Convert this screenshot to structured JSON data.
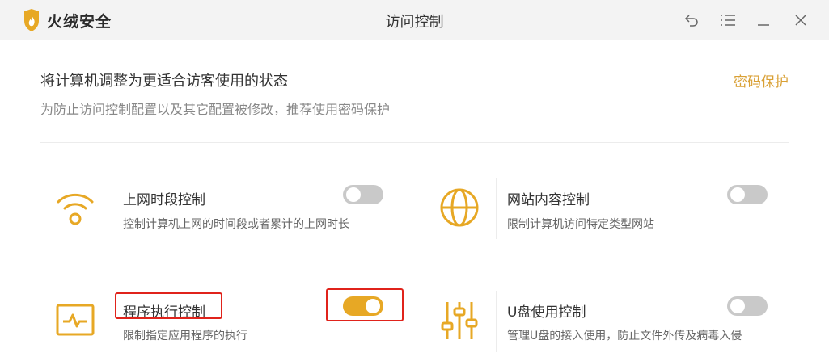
{
  "app": {
    "brand": "火绒安全",
    "window_title": "访问控制",
    "accent": "#e7a825",
    "link_color": "#d9a035",
    "highlight_color": "#e0231b"
  },
  "titlebar_icons": [
    "undo-icon",
    "menu-icon",
    "minimize-icon",
    "close-icon"
  ],
  "header": {
    "headline": "将计算机调整为更适合访客使用的状态",
    "subline": "为防止访问控制配置以及其它配置被修改，推荐使用密码保护",
    "password_link": "密码保护"
  },
  "cards": [
    {
      "icon": "wifi-icon",
      "title": "上网时段控制",
      "desc": "控制计算机上网的时间段或者累计的上网时长",
      "enabled": false
    },
    {
      "icon": "globe-icon",
      "title": "网站内容控制",
      "desc": "限制计算机访问特定类型网站",
      "enabled": false
    },
    {
      "icon": "program-monitor-icon",
      "title": "程序执行控制",
      "desc": "限制指定应用程序的执行",
      "enabled": true,
      "highlighted": true
    },
    {
      "icon": "sliders-icon",
      "title": "U盘使用控制",
      "desc": "管理U盘的接入使用，防止文件外传及病毒入侵",
      "enabled": false
    }
  ]
}
